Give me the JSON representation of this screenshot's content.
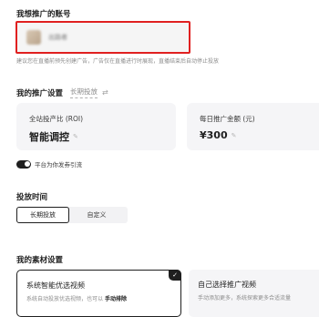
{
  "account": {
    "title": "我想推广的账号",
    "name": "出路者",
    "hint": "建议您在直播前预先创建广告，广告仅在直播进行时展现，直播结束后自动停止投放"
  },
  "promo_settings": {
    "title": "我的推广设置",
    "mode": "长期投放",
    "swap_icon": "swap-icon",
    "roi_card": {
      "label": "全站投产比 (ROI)",
      "value": "智能调控"
    },
    "budget_card": {
      "label": "每日推广金额 (元)",
      "value": "¥300"
    },
    "toggle": {
      "label": "平台为你发券引流",
      "on": true
    }
  },
  "schedule": {
    "title": "投放时间",
    "options": [
      "长期投放",
      "自定义"
    ],
    "selected": "长期投放"
  },
  "materials": {
    "title": "我的素材设置",
    "cards": [
      {
        "title": "系统智能优选视频",
        "desc_prefix": "系统自动投放优选视频，也可以",
        "desc_link": "手动排除",
        "selected": true
      },
      {
        "title": "自己选择推广视频",
        "desc": "手动添加更多，系统探索更多合适流量",
        "selected": false
      }
    ]
  },
  "colors": {
    "highlight_border": "#e02020",
    "card_bg": "#f5f5f7",
    "primary_dark": "#1f1f1f"
  }
}
